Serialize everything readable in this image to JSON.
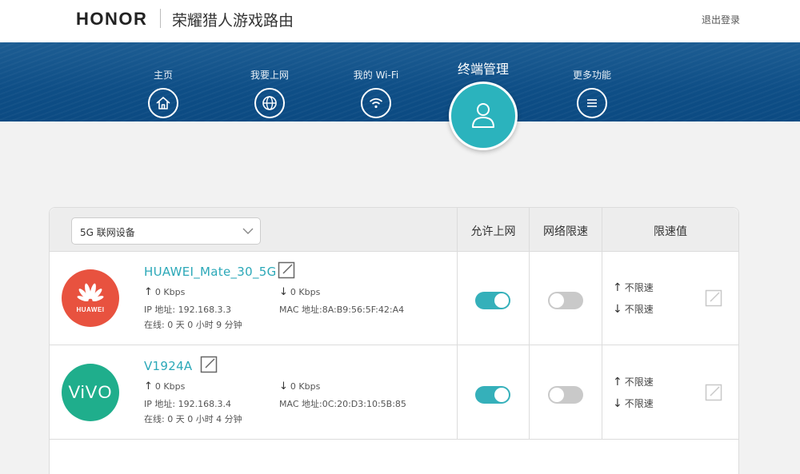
{
  "header": {
    "logo": "HONOR",
    "product": "荣耀猎人游戏路由",
    "logout": "退出登录"
  },
  "nav": {
    "items": [
      {
        "label": "主页",
        "icon": "home-icon"
      },
      {
        "label": "我要上网",
        "icon": "globe-icon"
      },
      {
        "label": "我的 Wi-Fi",
        "icon": "wifi-icon"
      },
      {
        "label": "终端管理",
        "icon": "user-icon",
        "active": true
      },
      {
        "label": "更多功能",
        "icon": "menu-icon"
      }
    ]
  },
  "table": {
    "filter": {
      "selected": "5G 联网设备"
    },
    "columns": {
      "allow": "允许上网",
      "limit": "网络限速",
      "value": "限速值"
    },
    "devices": [
      {
        "name": "HUAWEI_Mate_30_5G",
        "avatar_text": "HUAWEI",
        "up": "0 Kbps",
        "down": "0 Kbps",
        "ip": "IP 地址: 192.168.3.3",
        "mac": "MAC 地址:8A:B9:56:5F:42:A4",
        "online": "在线: 0 天 0 小时 9 分钟",
        "allow_internet": true,
        "speed_limit": false,
        "limit_up": "不限速",
        "limit_down": "不限速"
      },
      {
        "name": "V1924A",
        "avatar_text": "ViVO",
        "up": "0 Kbps",
        "down": "0 Kbps",
        "ip": "IP 地址: 192.168.3.4",
        "mac": "MAC 地址:0C:20:D3:10:5B:85",
        "online": "在线: 0 天 0 小时 4 分钟",
        "allow_internet": true,
        "speed_limit": false,
        "limit_up": "不限速",
        "limit_down": "不限速"
      }
    ]
  },
  "colors": {
    "accent": "#2bb3bd",
    "nav_bg": "#0e4e86",
    "huawei": "#e8523f",
    "vivo": "#1fae8c"
  }
}
